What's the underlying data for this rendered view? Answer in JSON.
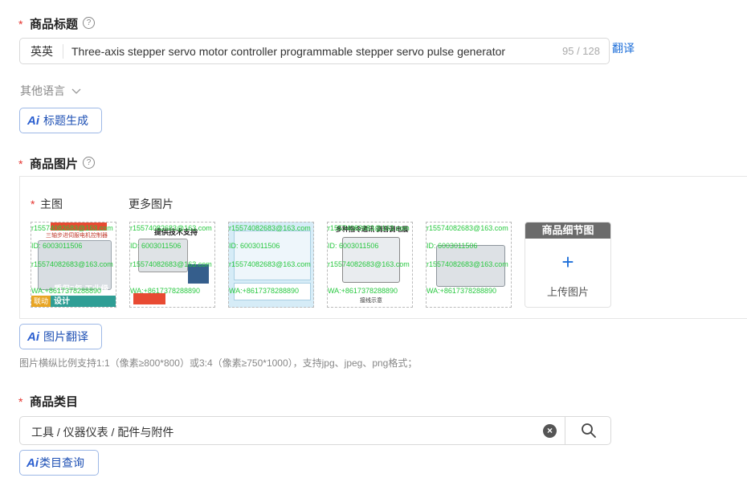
{
  "product_title": {
    "label": "商品标题",
    "help_icon": "?",
    "language": "英英",
    "value": "Three-axis stepper servo motor controller programmable stepper servo pulse generator",
    "count": "95 / 128",
    "translate_link": "翻译"
  },
  "other_languages": {
    "label": "其他语言"
  },
  "ai_title_button": {
    "ai": "Ai",
    "label": "标题生成"
  },
  "product_images": {
    "label": "商品图片",
    "help_icon": "?",
    "main_label": "主图",
    "more_label": "更多图片",
    "watermarks": {
      "email": "r15574082683@163.com",
      "id": "ID: 6003011506",
      "wa": "WA:+8617378288890"
    },
    "thumb_texts": {
      "t1_top": "三轴步进伺服电机控制器",
      "t1_bottom_left": "联动",
      "t1_bottom_right": "质保5年 工业级设计",
      "t2_top": "提供技术支持",
      "t4_top": "多种指令通讯 调音调电展",
      "t4_bottom": "接线示意"
    },
    "upload": {
      "head": "商品细节图",
      "plus": "+",
      "label": "上传图片"
    }
  },
  "ai_image_button": {
    "ai": "Ai",
    "label": "图片翻译"
  },
  "image_hint": "图片横纵比例支持1:1（像素≥800*800）或3:4（像素≥750*1000），支持jpg、jpeg、png格式；",
  "category": {
    "label": "商品类目",
    "value": "工具 / 仪器仪表 / 配件与附件",
    "clear_icon": "×"
  },
  "ai_category_button": {
    "ai": "Ai",
    "label": "类目查询"
  },
  "colors": {
    "accent": "#1e6fd9",
    "required": "#e5322d",
    "watermark": "#28c840"
  }
}
